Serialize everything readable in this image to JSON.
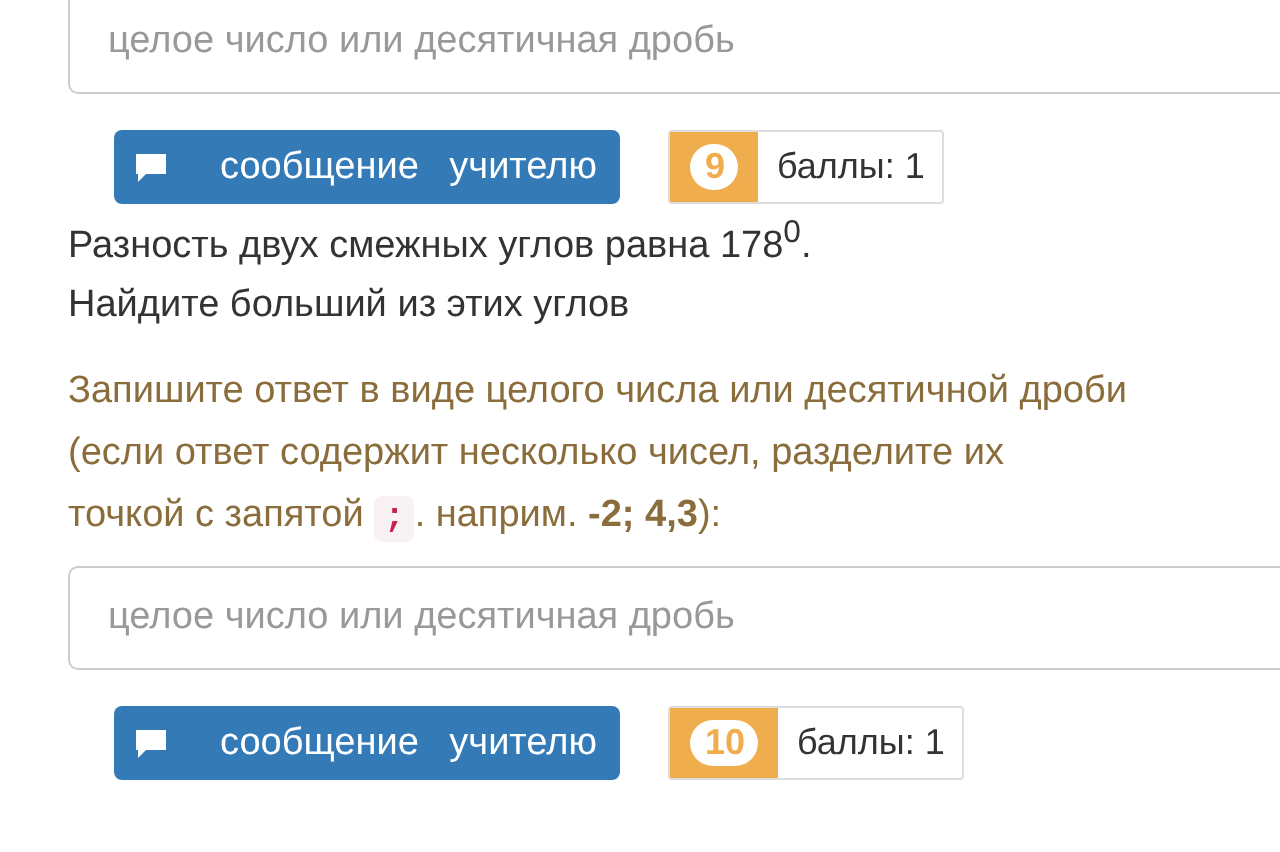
{
  "top_field": {
    "placeholder": "целое число или десятичная дробь"
  },
  "top_actions": {
    "message_button": "сообщение учителю",
    "number": "9",
    "points": "баллы: 1"
  },
  "question": {
    "lines": [
      "Разность двух смежных углов равна 178$^{0}$.",
      "Найдите больший из этих углов"
    ]
  },
  "instruction": {
    "text": "Запишите ответ в виде целого числа или десятичной дроби",
    "hint_lines": [
      "(если ответ содержит несколько чисел, разделите их",
      "точкой с запятой"
    ],
    "separator": ";",
    "hint_after": ". наприм. **-2; 4,3**):"
  },
  "answer_field": {
    "placeholder": "целое число или десятичная дробь"
  },
  "actions": {
    "message_button": "сообщение учителю",
    "number": "10",
    "points": "баллы: 1"
  }
}
